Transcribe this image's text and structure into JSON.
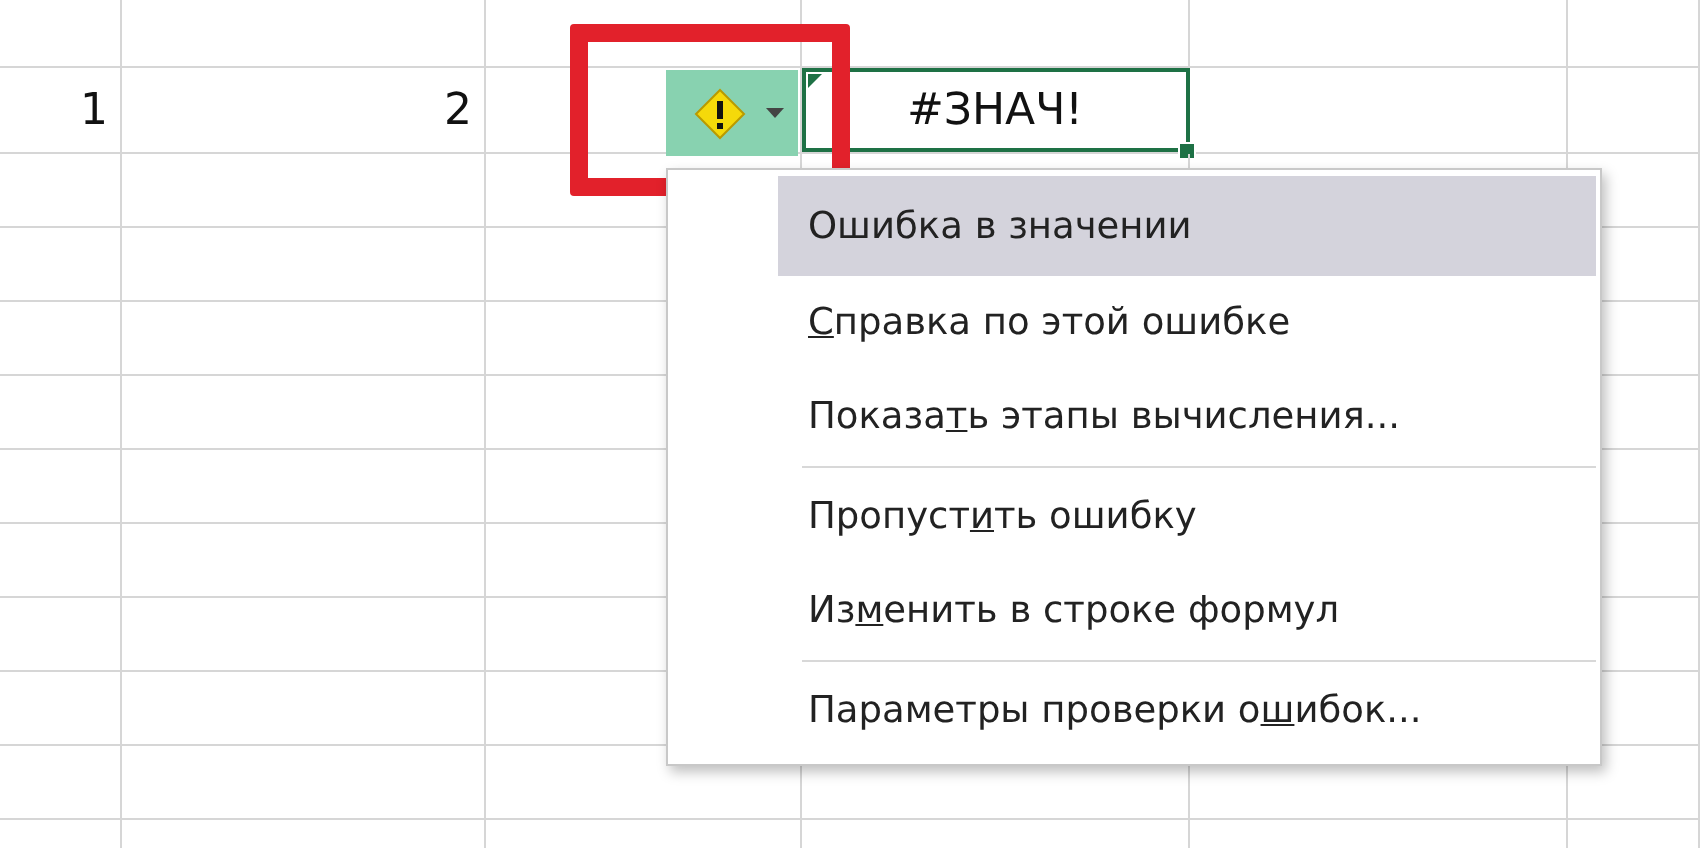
{
  "sheet": {
    "row": {
      "cells": [
        {
          "kind": "number",
          "text": "1"
        },
        {
          "kind": "number",
          "text": "2"
        },
        {
          "kind": "empty"
        },
        {
          "kind": "error",
          "text": "#ЗНАЧ!",
          "selected": true
        },
        {
          "kind": "empty"
        },
        {
          "kind": "empty"
        }
      ]
    }
  },
  "error_button": {
    "highlighted": true
  },
  "menu": {
    "title": "Ошибка в значении",
    "groups": [
      [
        {
          "parts": [
            {
              "text": "С",
              "underline": true
            },
            {
              "text": "правка по этой ошибке",
              "underline": false
            }
          ]
        },
        {
          "parts": [
            {
              "text": "Показа",
              "underline": false
            },
            {
              "text": "т",
              "underline": true
            },
            {
              "text": "ь этапы вычисления...",
              "underline": false
            }
          ]
        }
      ],
      [
        {
          "parts": [
            {
              "text": "Пропуст",
              "underline": false
            },
            {
              "text": "и",
              "underline": true
            },
            {
              "text": "ть ошибку",
              "underline": false
            }
          ]
        },
        {
          "parts": [
            {
              "text": "Из",
              "underline": false
            },
            {
              "text": "м",
              "underline": true
            },
            {
              "text": "енить в строке формул",
              "underline": false
            }
          ]
        }
      ],
      [
        {
          "parts": [
            {
              "text": "Параметры проверки о",
              "underline": false
            },
            {
              "text": "ш",
              "underline": true
            },
            {
              "text": "ибок...",
              "underline": false
            }
          ]
        }
      ]
    ]
  }
}
